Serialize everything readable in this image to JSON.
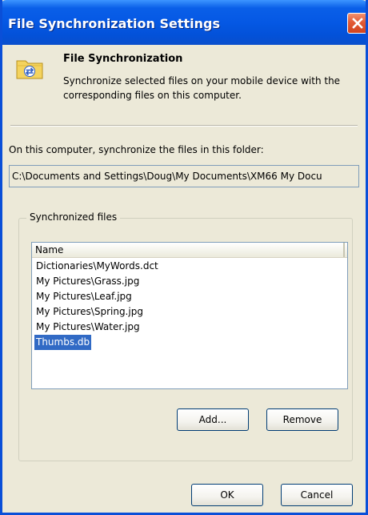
{
  "window": {
    "title": "File Synchronization Settings",
    "close_icon": "close-icon"
  },
  "header": {
    "icon": "sync-folder-icon",
    "title": "File Synchronization",
    "description": "Synchronize selected files on your mobile device with the corresponding files on this computer."
  },
  "folder": {
    "label": "On this computer, synchronize the files in this folder:",
    "path": "C:\\Documents and Settings\\Doug\\My Documents\\XM66 My Docu"
  },
  "synchronized_files": {
    "group_label": "Synchronized files",
    "column_header": "Name",
    "items": [
      {
        "name": "Dictionaries\\MyWords.dct",
        "selected": false
      },
      {
        "name": "My Pictures\\Grass.jpg",
        "selected": false
      },
      {
        "name": "My Pictures\\Leaf.jpg",
        "selected": false
      },
      {
        "name": "My Pictures\\Spring.jpg",
        "selected": false
      },
      {
        "name": "My Pictures\\Water.jpg",
        "selected": false
      },
      {
        "name": "Thumbs.db",
        "selected": true
      }
    ],
    "add_label": "Add...",
    "remove_label": "Remove"
  },
  "footer": {
    "ok_label": "OK",
    "cancel_label": "Cancel"
  },
  "colors": {
    "titlebar": "#0558e4",
    "selection": "#316ac5",
    "dialog_bg": "#ece9d8"
  }
}
